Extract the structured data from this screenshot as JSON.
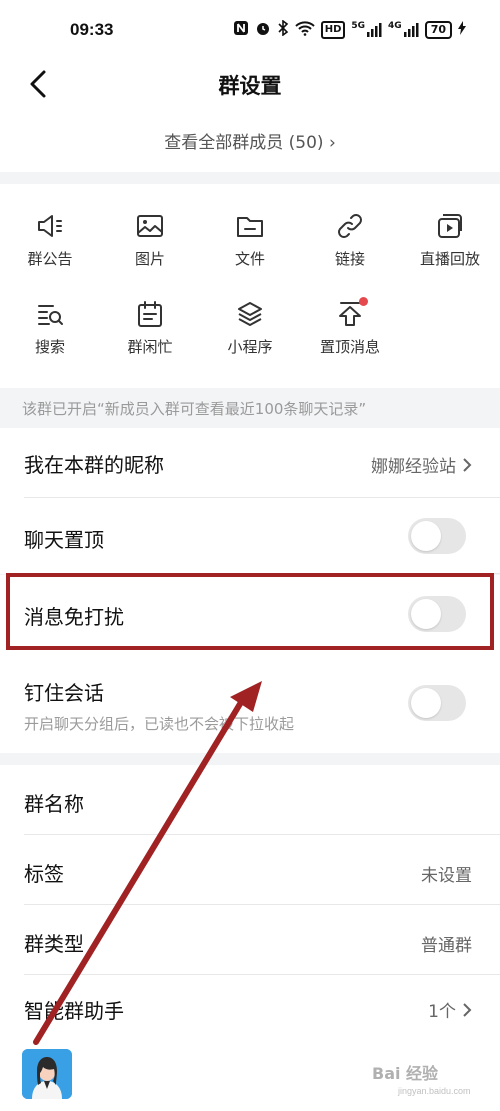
{
  "status_bar": {
    "time": "09:33",
    "icons": [
      "nfc-icon",
      "alarm-icon",
      "bluetooth-icon",
      "wifi-icon",
      "hd-icon",
      "signal-5g-icon",
      "signal-4g-icon",
      "battery-icon"
    ],
    "hd_label": "HD",
    "net1_label": "5G",
    "net2_label": "4G",
    "battery": "70"
  },
  "header": {
    "title": "群设置",
    "back_icon": "chevron-left-icon"
  },
  "members": {
    "label": "查看全部群成员 (50)",
    "chevron": "›"
  },
  "grid": {
    "items": [
      {
        "label": "群公告",
        "icon": "megaphone-icon"
      },
      {
        "label": "图片",
        "icon": "image-icon"
      },
      {
        "label": "文件",
        "icon": "folder-icon"
      },
      {
        "label": "链接",
        "icon": "link-icon"
      },
      {
        "label": "直播回放",
        "icon": "play-video-icon"
      },
      {
        "label": "搜索",
        "icon": "search-list-icon"
      },
      {
        "label": "群闲忙",
        "icon": "calendar-icon"
      },
      {
        "label": "小程序",
        "icon": "layers-icon"
      },
      {
        "label": "置顶消息",
        "icon": "pin-top-icon"
      }
    ]
  },
  "notice": {
    "text": "该群已开启“新成员入群可查看最近100条聊天记录”"
  },
  "settings": {
    "nickname_label": "我在本群的昵称",
    "nickname_value": "娜娜经验站",
    "pin_chat_label": "聊天置顶",
    "pin_chat_on": false,
    "mute_label": "消息免打扰",
    "mute_on": false,
    "stick_label": "钉住会话",
    "stick_sub": "开启聊天分组后，已读也不会被下拉收起",
    "stick_on": false
  },
  "group_info": {
    "name_label": "群名称",
    "tag_label": "标签",
    "tag_value": "未设置",
    "type_label": "群类型",
    "type_value": "普通群",
    "assistant_label": "智能群助手",
    "assistant_value": "1个"
  },
  "annotation": {
    "highlight_color": "#a12222"
  },
  "watermark": {
    "text": "Bai 经验",
    "url": "jingyan.baidu.com"
  },
  "colors": {
    "background": "#f3f4f6",
    "toggle_off": "#e6e6e6",
    "badge_red": "#e5484d"
  }
}
